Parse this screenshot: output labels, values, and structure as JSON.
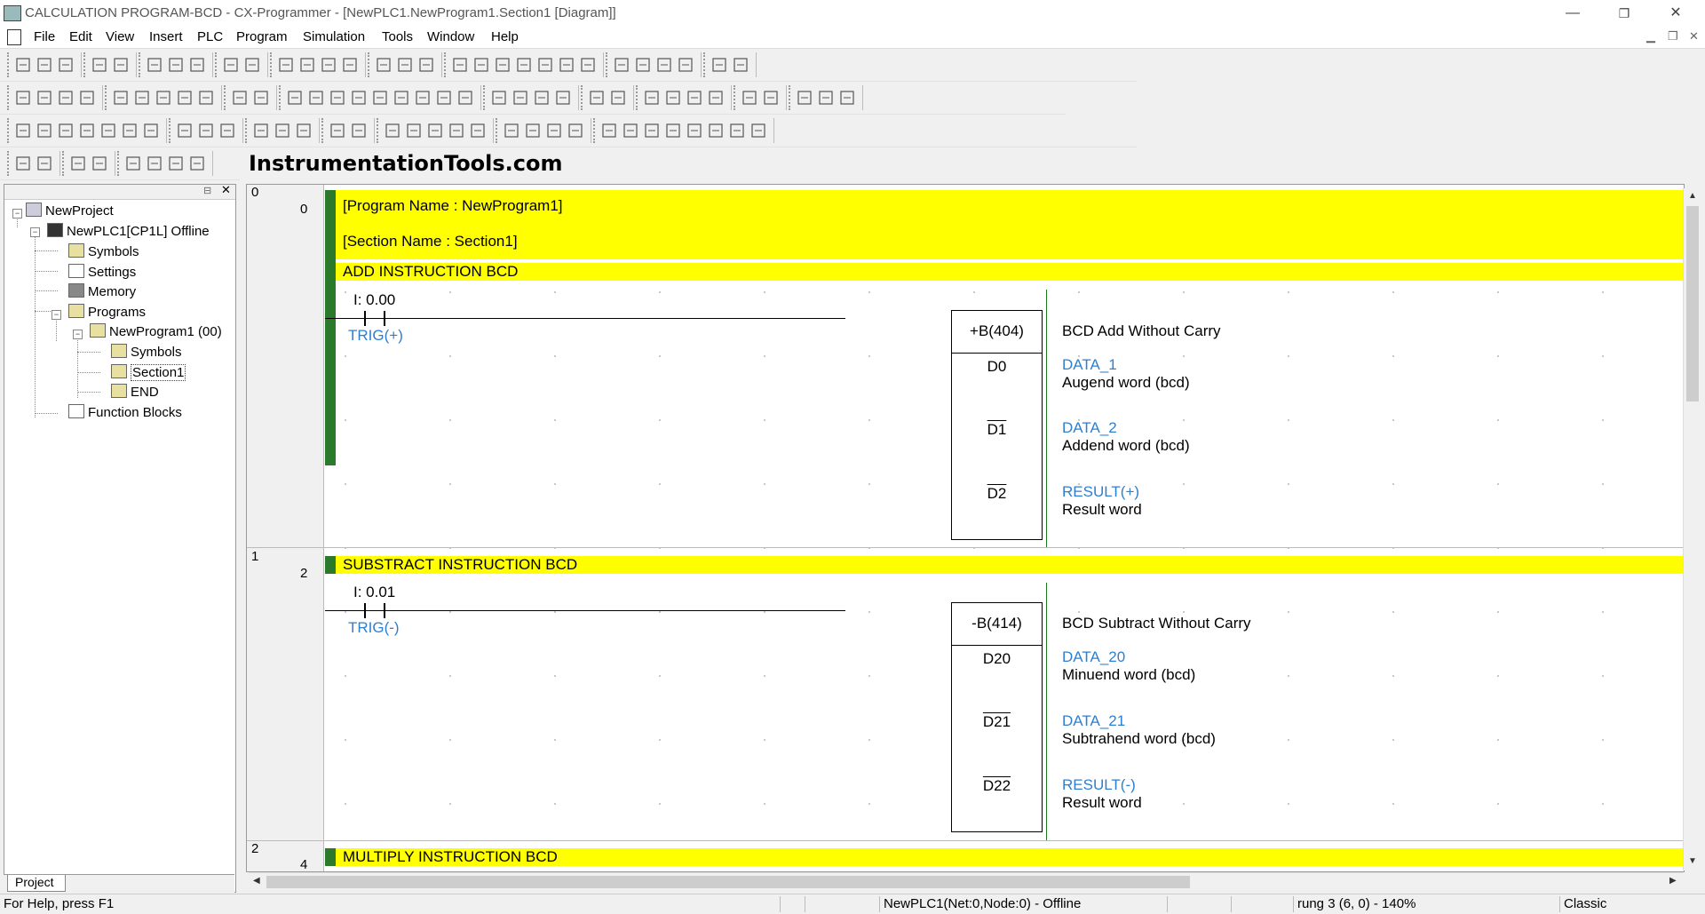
{
  "window": {
    "title": "CALCULATION PROGRAM-BCD - CX-Programmer - [NewPLC1.NewProgram1.Section1 [Diagram]]",
    "minimize": "—",
    "restore": "❐",
    "close": "✕"
  },
  "menu": [
    "File",
    "Edit",
    "View",
    "Insert",
    "PLC",
    "Program",
    "Simulation",
    "Tools",
    "Window",
    "Help"
  ],
  "brand": "InstrumentationTools.com",
  "tree": {
    "project": "NewProject",
    "plc": "NewPLC1[CP1L] Offline",
    "symbols": "Symbols",
    "settings": "Settings",
    "memory": "Memory",
    "programs": "Programs",
    "program": "NewProgram1 (00)",
    "prog_symbols": "Symbols",
    "section1": "Section1",
    "end": "END",
    "function_blocks": "Function Blocks",
    "tab": "Project"
  },
  "rungs": [
    {
      "index": "0",
      "step": "0",
      "program_name": "[Program Name : NewProgram1]",
      "section_name": "[Section Name : Section1]",
      "comment": "ADD INSTRUCTION BCD",
      "contact_address": "I: 0.00",
      "contact_name": "TRIG(+)",
      "instruction": "+B(404)",
      "description": "BCD Add Without Carry",
      "operands": [
        {
          "op": "D0",
          "symbol": "DATA_1",
          "comment": "Augend word (bcd)"
        },
        {
          "op": "D1",
          "symbol": "DATA_2",
          "comment": "Addend word (bcd)"
        },
        {
          "op": "D2",
          "symbol": "RESULT(+)",
          "comment": "Result word"
        }
      ]
    },
    {
      "index": "1",
      "step": "2",
      "comment": "SUBSTRACT INSTRUCTION BCD",
      "contact_address": "I: 0.01",
      "contact_name": "TRIG(-)",
      "instruction": "-B(414)",
      "description": "BCD Subtract Without Carry",
      "operands": [
        {
          "op": "D20",
          "symbol": "DATA_20",
          "comment": "Minuend word (bcd)"
        },
        {
          "op": "D21",
          "symbol": "DATA_21",
          "comment": "Subtrahend word (bcd)"
        },
        {
          "op": "D22",
          "symbol": "RESULT(-)",
          "comment": "Result word"
        }
      ]
    },
    {
      "index": "2",
      "step": "4",
      "comment": "MULTIPLY INSTRUCTION BCD"
    }
  ],
  "status": {
    "help": "For Help, press F1",
    "connection": "NewPLC1(Net:0,Node:0) - Offline",
    "position": "rung 3 (6, 0)  - 140%",
    "mode": "Classic"
  },
  "colors": {
    "comment_bg": "#ffff00",
    "rung_bar": "#2b7a2b",
    "symbol_text": "#2e7fd0"
  }
}
